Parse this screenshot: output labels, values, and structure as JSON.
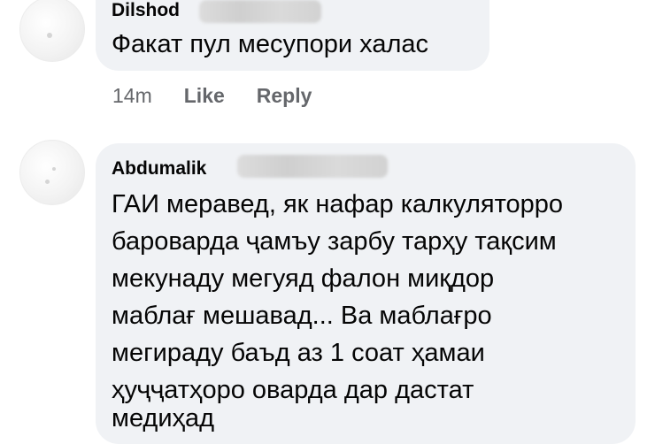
{
  "comments": [
    {
      "author": "Dilshod",
      "text": "Факат пул месупори халас",
      "time": "14m",
      "actions": {
        "like": "Like",
        "reply": "Reply"
      }
    },
    {
      "author": "Abdumalik",
      "lines": [
        "ГАИ меравед, як нафар калкуляторро",
        "бароварда ҷамъу зарбу тарҳу тақсим",
        "мекунаду мегуяд фалон миқдор",
        "маблағ мешавад... Ва маблағро",
        "мегираду баъд аз 1 соат ҳамаи",
        "ҳуҷҷатҳоро оварда дар дастат",
        "медиҳад"
      ]
    }
  ]
}
